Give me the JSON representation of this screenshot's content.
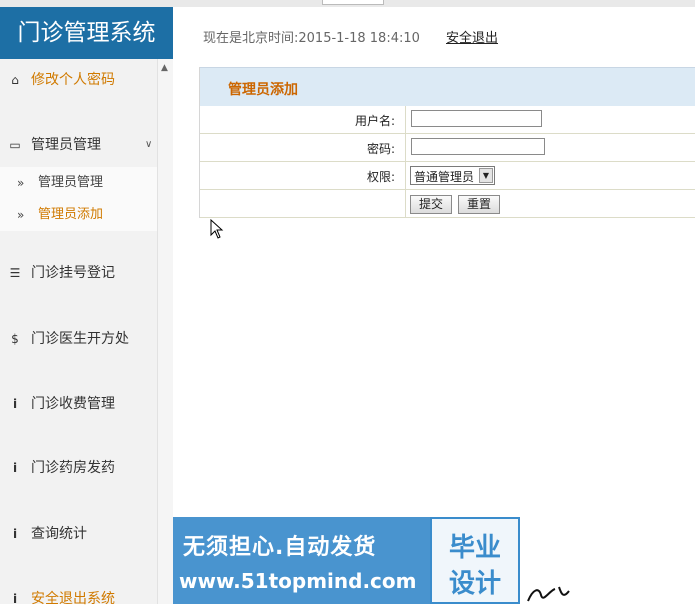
{
  "app": {
    "title": "门诊管理系统"
  },
  "header": {
    "time_text": "现在是北京时间:2015-1-18 18:4:10",
    "logout_label": "安全退出"
  },
  "sidebar": {
    "items": [
      {
        "icon": "home-icon",
        "label": "修改个人密码"
      },
      {
        "icon": "inbox-icon",
        "label": "管理员管理"
      },
      {
        "icon": "list-icon",
        "label": "门诊挂号登记"
      },
      {
        "icon": "dollar-icon",
        "label": "门诊医生开方处"
      },
      {
        "icon": "info-icon",
        "label": "门诊收费管理"
      },
      {
        "icon": "info-icon",
        "label": "门诊药房发药"
      },
      {
        "icon": "info-icon",
        "label": "查询统计"
      },
      {
        "icon": "info-icon",
        "label": "安全退出系统"
      }
    ],
    "sub_items": [
      {
        "icon": "double-chevron-right-icon",
        "label": "管理员管理"
      },
      {
        "icon": "double-chevron-right-icon",
        "label": "管理员添加"
      }
    ]
  },
  "form": {
    "title": "管理员添加",
    "username_label": "用户名:",
    "username_value": "",
    "password_label": "密码:",
    "password_value": "",
    "role_label": "权限:",
    "role_selected": "普通管理员",
    "submit_label": "提交",
    "reset_label": "重置"
  },
  "watermark": {
    "line1": "无须担心.自动发货",
    "line2": "www.51topmind.com",
    "badge_top": "毕业",
    "badge_bottom": "设计"
  },
  "colors": {
    "logo_bg": "#1d6fa5",
    "accent_orange": "#d07a00",
    "panel_title_bg": "#dceaf5",
    "watermark_blue": "#3a8ccc"
  }
}
